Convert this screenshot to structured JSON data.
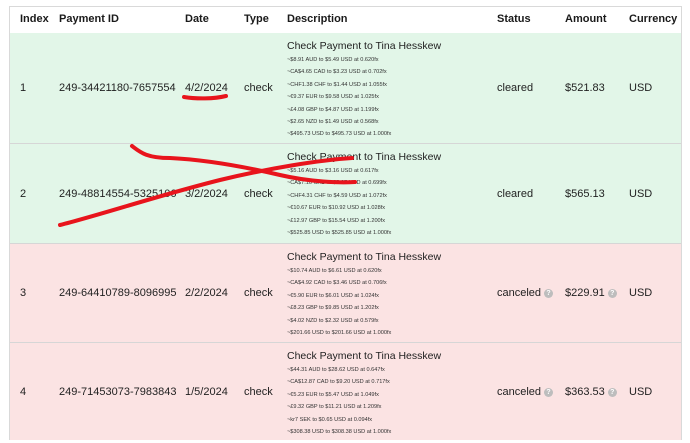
{
  "columns": {
    "index": "Index",
    "payment_id": "Payment ID",
    "date": "Date",
    "type": "Type",
    "description": "Description",
    "status": "Status",
    "amount": "Amount",
    "currency": "Currency"
  },
  "colors": {
    "cleared_row": "#e2f6e8",
    "canceled_row": "#fbe3e3",
    "annotation": "#e8141c"
  },
  "rows": [
    {
      "index": "1",
      "payment_id": "249-34421180-7657554",
      "date": "4/2/2024",
      "type": "check",
      "title": "Check Payment to Tina Hesskew",
      "conversions": [
        "~$8.91 AUD to $5.49 USD at 0.620fx",
        "~CA$4.65 CAD to $3.23 USD at 0.702fx",
        "~CHF1.38 CHF to $1.44 USD at 1.055fx",
        "~€9.37 EUR to $9.58 USD at 1.025fx",
        "~£4.08 GBP to $4.87 USD at 1.199fx",
        "~$2.65 NZD to $1.49 USD at 0.568fx",
        "~$495.73 USD to $495.73 USD at 1.000fx"
      ],
      "status": "cleared",
      "amount": "$521.83",
      "currency": "USD"
    },
    {
      "index": "2",
      "payment_id": "249-48814554-5325106",
      "date": "3/2/2024",
      "type": "check",
      "title": "Check Payment to Tina Hesskew",
      "conversions": [
        "~$5.16 AUD to $3.16 USD at 0.617fx",
        "~CA$7.10 CAD to $5.07 USD at 0.699fx",
        "~CHF4.31 CHF to $4.59 USD at 1.072fx",
        "~€10.67 EUR to $10.92 USD at 1.028fx",
        "~£12.97 GBP to $15.54 USD at 1.200fx",
        "~$525.85 USD to $525.85 USD at 1.000fx"
      ],
      "status": "cleared",
      "amount": "$565.13",
      "currency": "USD"
    },
    {
      "index": "3",
      "payment_id": "249-64410789-8096995",
      "date": "2/2/2024",
      "type": "check",
      "title": "Check Payment to Tina Hesskew",
      "conversions": [
        "~$10.74 AUD to $6.61 USD at 0.620fx",
        "~CA$4.92 CAD to $3.46 USD at 0.706fx",
        "~€5.90 EUR to $6.01 USD at 1.024fx",
        "~£8.23 GBP to $9.85 USD at 1.202fx",
        "~$4.02 NZD to $2.32 USD at 0.579fx",
        "~$201.66 USD to $201.66 USD at 1.000fx"
      ],
      "status": "canceled",
      "amount": "$229.91",
      "currency": "USD"
    },
    {
      "index": "4",
      "payment_id": "249-71453073-7983843",
      "date": "1/5/2024",
      "type": "check",
      "title": "Check Payment to Tina Hesskew",
      "conversions": [
        "~$44.31 AUD to $28.62 USD at 0.647fx",
        "~CA$12.87 CAD to $9.20 USD at 0.717fx",
        "~€5.23 EUR to $5.47 USD at 1.049fx",
        "~£9.32 GBP to $11.21 USD at 1.209fx",
        "~kr7 SEK to $0.65 USD at 0.094fx",
        "~$308.38 USD to $308.38 USD at 1.000fx"
      ],
      "status": "canceled",
      "amount": "$363.53",
      "currency": "USD"
    }
  ]
}
